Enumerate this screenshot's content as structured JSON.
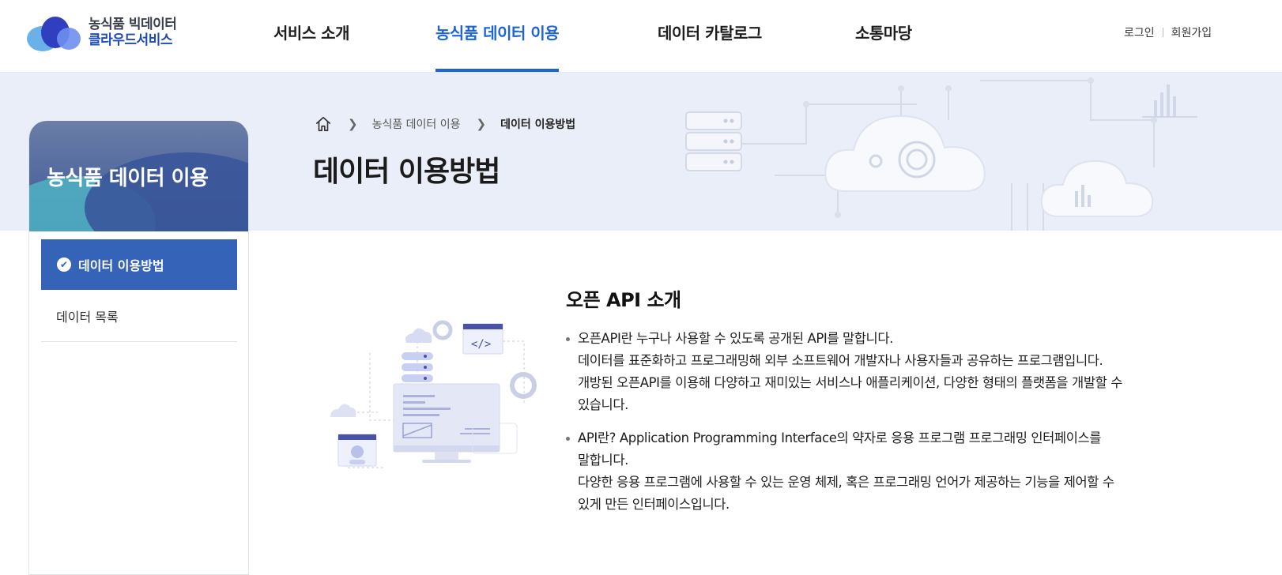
{
  "logo": {
    "line1": "농식품 빅데이터",
    "line2": "클라우드서비스"
  },
  "nav": {
    "items": [
      "서비스 소개",
      "농식품 데이터 이용",
      "데이터 카탈로그",
      "소통마당"
    ],
    "active_index": 1
  },
  "util": {
    "login": "로그인",
    "signup": "회원가입"
  },
  "breadcrumb": {
    "level1": "농식품 데이터 이용",
    "level2": "데이터 이용방법"
  },
  "page_title": "데이터 이용방법",
  "sidebar": {
    "title": "농식품 데이터 이용",
    "items": [
      {
        "label": "데이터 이용방법",
        "active": true
      },
      {
        "label": "데이터 목록",
        "active": false
      }
    ]
  },
  "content": {
    "heading": "오픈 API 소개",
    "bullets": [
      {
        "lines": [
          "오픈API란 누구나 사용할 수 있도록 공개된 API를 말합니다.",
          "데이터를 표준화하고 프로그래밍해 외부 소프트웨어 개발자나 사용자들과 공유하는 프로그램입니다.",
          "개방된 오픈API를 이용해 다양하고 재미있는 서비스나 애플리케이션, 다양한 형태의 플랫폼을 개발할 수",
          "있습니다."
        ]
      },
      {
        "lines": [
          "API란? Application Programming Interface의 약자로 응용 프로그램 프로그래밍 인터페이스를",
          "말합니다.",
          "다양한 응용 프로그램에 사용할 수 있는 운영 체제, 혹은 프로그래밍 언어가 제공하는 기능을 제어할 수",
          "있게 만든 인터페이스입니다."
        ]
      }
    ]
  },
  "colors": {
    "accent": "#1b63d6",
    "side_active": "#3463b8",
    "banner_bg": "#eaeef8"
  }
}
